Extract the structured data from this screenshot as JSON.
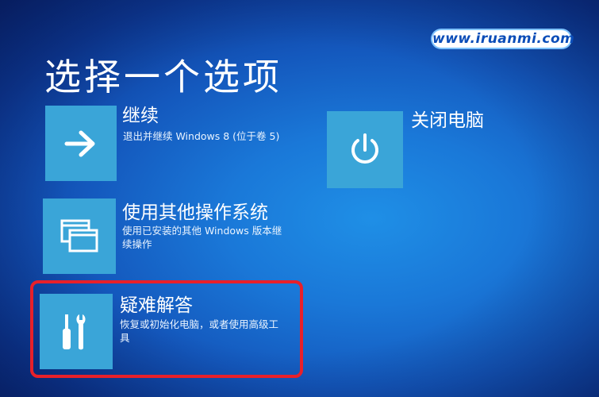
{
  "page": {
    "title": "选择一个选项"
  },
  "watermark": {
    "text": "www.iruanmi.com"
  },
  "options": {
    "continue": {
      "title": "继续",
      "description": "退出并继续 Windows 8 (位于卷 5)",
      "icon": "arrow-right-icon"
    },
    "other_os": {
      "title": "使用其他操作系统",
      "description": "使用已安装的其他 Windows 版本继续操作",
      "icon": "windows-stack-icon"
    },
    "troubleshoot": {
      "title": "疑难解答",
      "description": "恢复或初始化电脑，或者使用高级工具",
      "icon": "tools-icon"
    },
    "shutdown": {
      "title": "关闭电脑",
      "icon": "power-icon"
    }
  },
  "colors": {
    "background": "#1a78d8",
    "tile": "#3aa5d8",
    "highlight_border": "#e8202a",
    "text": "#ffffff"
  }
}
